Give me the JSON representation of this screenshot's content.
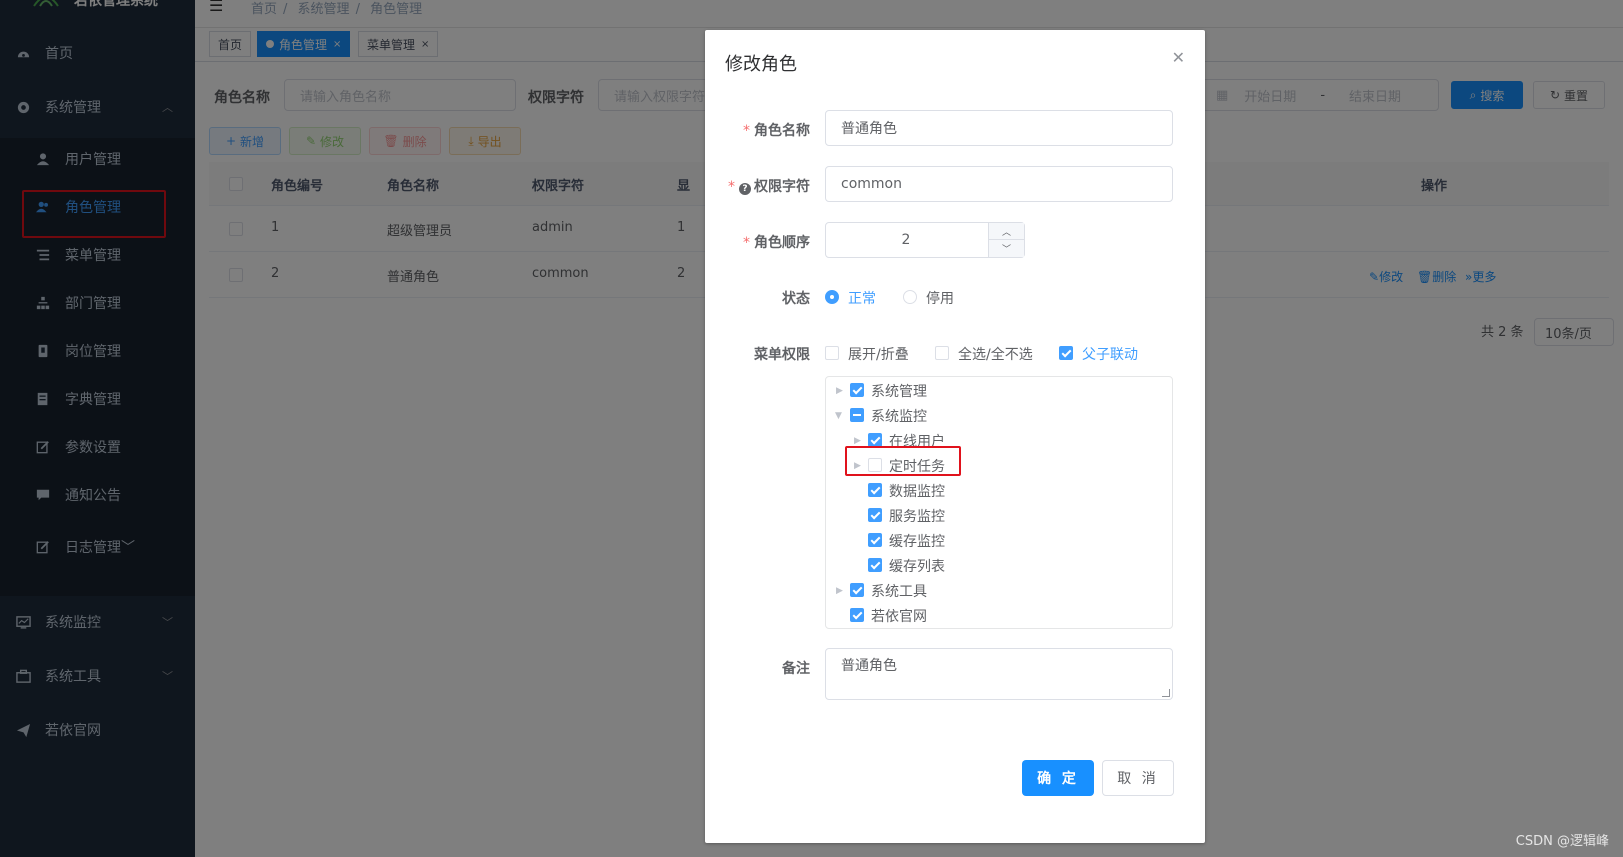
{
  "app": {
    "title": "若依管理系统"
  },
  "breadcrumb": [
    "首页",
    "系统管理",
    "角色管理"
  ],
  "tags": [
    {
      "label": "首页",
      "active": false
    },
    {
      "label": "角色管理",
      "active": true
    },
    {
      "label": "菜单管理",
      "active": false
    }
  ],
  "sidebar": {
    "home": "首页",
    "system": "系统管理",
    "items": [
      {
        "label": "用户管理",
        "icon": "user-icon"
      },
      {
        "label": "角色管理",
        "icon": "peoples-icon"
      },
      {
        "label": "菜单管理",
        "icon": "tree-table-icon"
      },
      {
        "label": "部门管理",
        "icon": "tree-icon"
      },
      {
        "label": "岗位管理",
        "icon": "post-icon"
      },
      {
        "label": "字典管理",
        "icon": "dict-icon"
      },
      {
        "label": "参数设置",
        "icon": "edit-icon"
      },
      {
        "label": "通知公告",
        "icon": "message-icon"
      },
      {
        "label": "日志管理",
        "icon": "log-icon"
      }
    ],
    "monitor": "系统监控",
    "tool": "系统工具",
    "site": "若依官网"
  },
  "query": {
    "role_name_label": "角色名称",
    "role_name_placeholder": "请输入角色名称",
    "role_key_label": "权限字符",
    "role_key_placeholder": "请输入权限字符",
    "start_date": "开始日期",
    "date_sep": "-",
    "end_date": "结束日期",
    "search": "搜索",
    "reset": "重置"
  },
  "toolbar": {
    "add": "新增",
    "edit": "修改",
    "delete": "删除",
    "export": "导出"
  },
  "table": {
    "headers": [
      "角色编号",
      "角色名称",
      "权限字符",
      "显",
      "操作"
    ],
    "rows": [
      {
        "id": "1",
        "name": "超级管理员",
        "key": "admin",
        "sort": "1"
      },
      {
        "id": "2",
        "name": "普通角色",
        "key": "common",
        "sort": "2"
      }
    ],
    "ops": {
      "edit": "修改",
      "delete": "删除",
      "more": "更多"
    }
  },
  "pagination": {
    "total": "共 2 条",
    "page_size": "10条/页"
  },
  "dialog": {
    "title": "修改角色",
    "role_name_label": "角色名称",
    "role_name_value": "普通角色",
    "role_key_label": "权限字符",
    "role_key_value": "common",
    "sort_label": "角色顺序",
    "sort_value": "2",
    "status_label": "状态",
    "status_normal": "正常",
    "status_disabled": "停用",
    "menu_label": "菜单权限",
    "expand": "展开/折叠",
    "select_all": "全选/全不选",
    "linkage": "父子联动",
    "tree": [
      {
        "label": "系统管理",
        "level": 0,
        "state": "checked",
        "arrow": "collapsed"
      },
      {
        "label": "系统监控",
        "level": 0,
        "state": "half",
        "arrow": "expanded"
      },
      {
        "label": "在线用户",
        "level": 1,
        "state": "checked",
        "arrow": "collapsed"
      },
      {
        "label": "定时任务",
        "level": 1,
        "state": "unchecked",
        "arrow": "collapsed"
      },
      {
        "label": "数据监控",
        "level": 1,
        "state": "checked",
        "arrow": "none"
      },
      {
        "label": "服务监控",
        "level": 1,
        "state": "checked",
        "arrow": "none"
      },
      {
        "label": "缓存监控",
        "level": 1,
        "state": "checked",
        "arrow": "none"
      },
      {
        "label": "缓存列表",
        "level": 1,
        "state": "checked",
        "arrow": "none"
      },
      {
        "label": "系统工具",
        "level": 0,
        "state": "checked",
        "arrow": "collapsed"
      },
      {
        "label": "若依官网",
        "level": 0,
        "state": "checked",
        "arrow": "none"
      }
    ],
    "remark_label": "备注",
    "remark_value": "普通角色",
    "ok": "确 定",
    "cancel": "取 消"
  },
  "watermark": "CSDN @逻辑峰",
  "colors": {
    "primary": "#1890ff",
    "sidebar": "#1f2d3d",
    "highlight": "#e0121c"
  }
}
